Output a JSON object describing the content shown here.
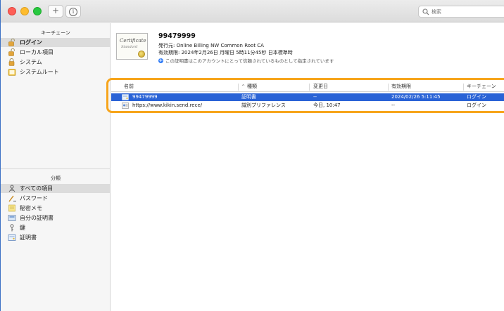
{
  "toolbar": {
    "add_label": "+",
    "info_label": "i",
    "search_placeholder": "検索"
  },
  "sidebar": {
    "keychains_header": "キーチェーン",
    "keychains": [
      {
        "label": "ログイン",
        "icon": "lock-open-icon",
        "selected": true
      },
      {
        "label": "ローカル項目",
        "icon": "lock-open-icon",
        "selected": false
      },
      {
        "label": "システム",
        "icon": "lock-icon",
        "selected": false
      },
      {
        "label": "システムルート",
        "icon": "folder-icon",
        "selected": false
      }
    ],
    "categories_header": "分類",
    "categories": [
      {
        "label": "すべての項目",
        "icon": "people-icon",
        "selected": true
      },
      {
        "label": "パスワード",
        "icon": "password-icon",
        "selected": false
      },
      {
        "label": "秘密メモ",
        "icon": "note-icon",
        "selected": false
      },
      {
        "label": "自分の証明書",
        "icon": "my-certificate-icon",
        "selected": false
      },
      {
        "label": "鍵",
        "icon": "key-icon",
        "selected": false
      },
      {
        "label": "証明書",
        "icon": "certificate-icon",
        "selected": false
      }
    ]
  },
  "detail": {
    "title": "99479999",
    "issuer": "発行元: Online Billing NW Common Root CA",
    "expiry": "有効期限: 2024年2月26日 月曜日 5時11分45秒 日本標準時",
    "trust": "この証明書はこのアカウントにとって信頼されているものとして指定されています",
    "image_text_1": "Certificate",
    "image_text_2": "Standard"
  },
  "table": {
    "headers": {
      "name": "名前",
      "kind": "種類",
      "modified": "変更日",
      "expires": "有効期限",
      "keychain": "キーチェーン"
    },
    "rows": [
      {
        "name": "99479999",
        "kind": "証明書",
        "modified": "--",
        "expires": "2024/02/26 5:11:45",
        "keychain": "ログイン",
        "icon": "certificate-icon",
        "selected": true
      },
      {
        "name": "https://www.kikin.send.rece/",
        "kind": "識別プリファレンス",
        "modified": "今日, 10:47",
        "expires": "--",
        "keychain": "ログイン",
        "icon": "identity-preference-icon",
        "selected": false
      }
    ]
  },
  "colors": {
    "selection": "#2a63d6",
    "highlight": "#f7a51c",
    "accent": "#2f7bf6"
  }
}
